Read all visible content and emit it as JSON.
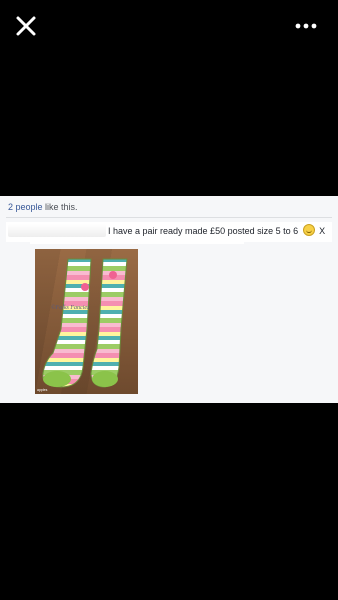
{
  "viewer": {
    "close_icon": "close-icon",
    "more_icon": "more-options-icon"
  },
  "post": {
    "likes_count": "2 people",
    "likes_suffix": " like this.",
    "comment": {
      "text": "I have a pair ready made £50 posted size 5 to 6",
      "emoji": "smile-emoji",
      "trail": " X"
    },
    "photo": {
      "watermark": "©Folks Fancies",
      "caption": "apples"
    }
  }
}
